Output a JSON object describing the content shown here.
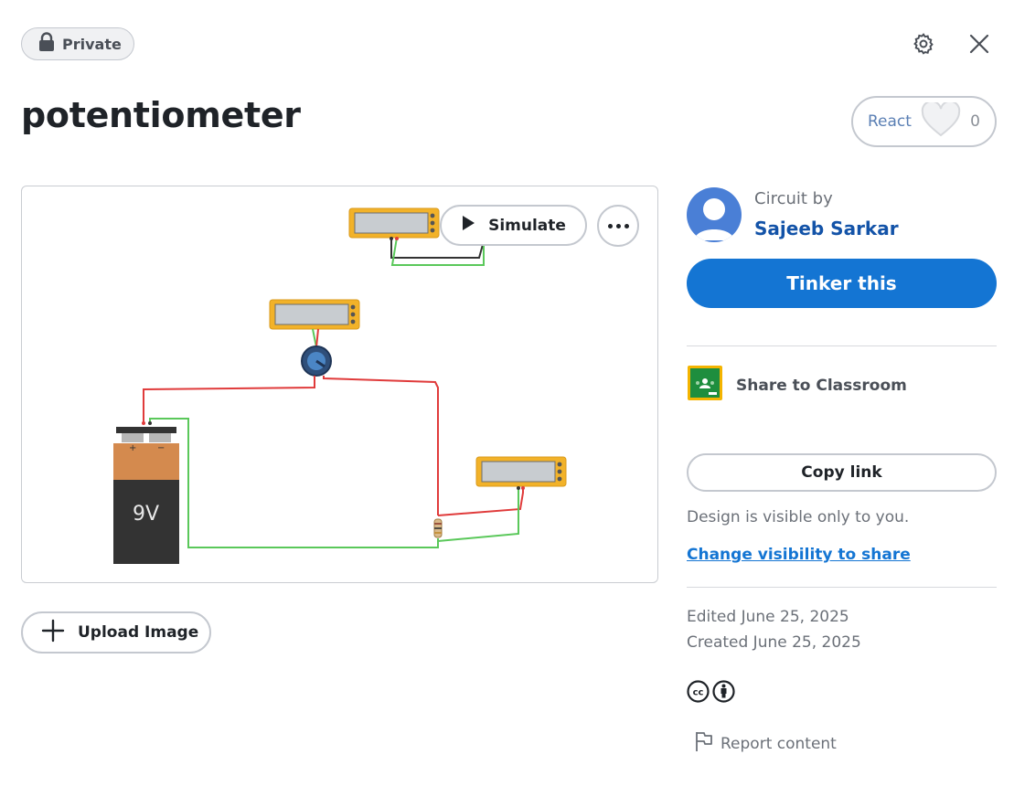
{
  "header": {
    "visibility_label": "Private"
  },
  "design": {
    "title": "potentiometer"
  },
  "react": {
    "label": "React",
    "count": "0"
  },
  "canvas": {
    "simulate_label": "Simulate",
    "battery_label": "9V",
    "battery_plus": "+",
    "battery_minus": "−"
  },
  "upload": {
    "label": "Upload Image"
  },
  "author": {
    "prefix": "Circuit by",
    "name": "Sajeeb Sarkar"
  },
  "actions": {
    "tinker_label": "Tinker this",
    "classroom_label": "Share to Classroom",
    "copy_link_label": "Copy link",
    "visibility_note": "Design is visible only to you.",
    "change_visibility_label": "Change visibility to share"
  },
  "meta": {
    "edited": "Edited June 25, 2025",
    "created": "Created June 25, 2025"
  },
  "license": {
    "cc_text": "cc"
  },
  "report": {
    "label": "Report content"
  },
  "colors": {
    "primary": "#1475d3",
    "author_link": "#1353a8",
    "wire_red": "#e03b3b",
    "wire_green": "#5ac85a",
    "multimeter": "#f2b229",
    "battery_body": "#333333",
    "battery_top": "#d48a4e",
    "classroom_green": "#1e8e3e"
  }
}
